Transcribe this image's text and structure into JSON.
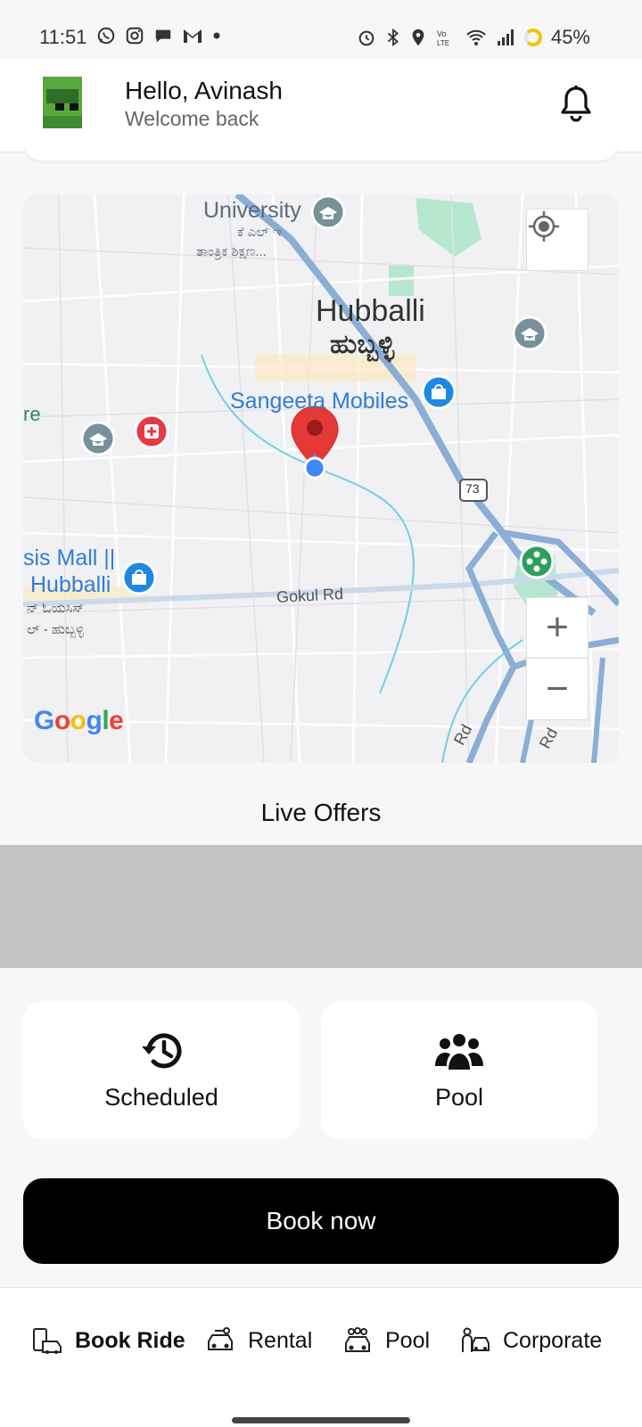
{
  "status_bar": {
    "time": "11:51",
    "battery": "45%",
    "notification_icons": [
      "whatsapp-icon",
      "instagram-icon",
      "chat-icon",
      "gmail-icon",
      "dot-icon"
    ],
    "system_icons": [
      "alarm-icon",
      "bluetooth-icon",
      "location-icon",
      "volte-icon",
      "wifi-icon",
      "signal-icon",
      "battery-icon"
    ]
  },
  "header": {
    "greeting": "Hello, Avinash",
    "subtitle": "Welcome back"
  },
  "map": {
    "labels": {
      "university": "University",
      "university_kn1": "ಕೆ ಎಲ್ ಇ",
      "university_kn2": "ತಾಂತ್ರಿಕ ಶಿಕ್ಷಣ...",
      "city": "Hubballi",
      "city_kn": "ಹುಬ್ಬಳ್ಳಿ",
      "sangeeta": "Sangeeta Mobiles",
      "mall_line1": "sis Mall ||",
      "mall_line2": "Hubballi",
      "mall_kn1": "ನ್ ಓಯಸಿಸ್",
      "mall_kn2": "ಲ್ - ಹುಬ್ಬಳ್ಳಿ",
      "edge_re": "re",
      "gokul_rd": "Gokul Rd",
      "rd1": "Rd",
      "rd2": "Rd",
      "highway": "73"
    },
    "google_letters": [
      "G",
      "o",
      "o",
      "g",
      "l",
      "e"
    ],
    "zoom_in_symbol": "+",
    "zoom_out_symbol": "−",
    "colors": {
      "marker": "#e53935",
      "road": "#8aaed6",
      "park": "#b7e6cf",
      "shop_pin": "#1e88e5",
      "school_pin": "#78909c",
      "hospital_pin": "#e53945",
      "park_pin": "#2e9e5e"
    }
  },
  "offers": {
    "title": "Live Offers"
  },
  "options": [
    {
      "label": "Scheduled",
      "icon": "history-icon"
    },
    {
      "label": "Pool",
      "icon": "people-group-icon"
    }
  ],
  "book_button": "Book now",
  "bottom_nav": [
    {
      "label": "Book Ride",
      "icon": "car-phone-icon",
      "active": true
    },
    {
      "label": "Rental",
      "icon": "car-key-icon",
      "active": false
    },
    {
      "label": "Pool",
      "icon": "car-people-icon",
      "active": false
    },
    {
      "label": "Corporate",
      "icon": "car-person-icon",
      "active": false
    }
  ]
}
